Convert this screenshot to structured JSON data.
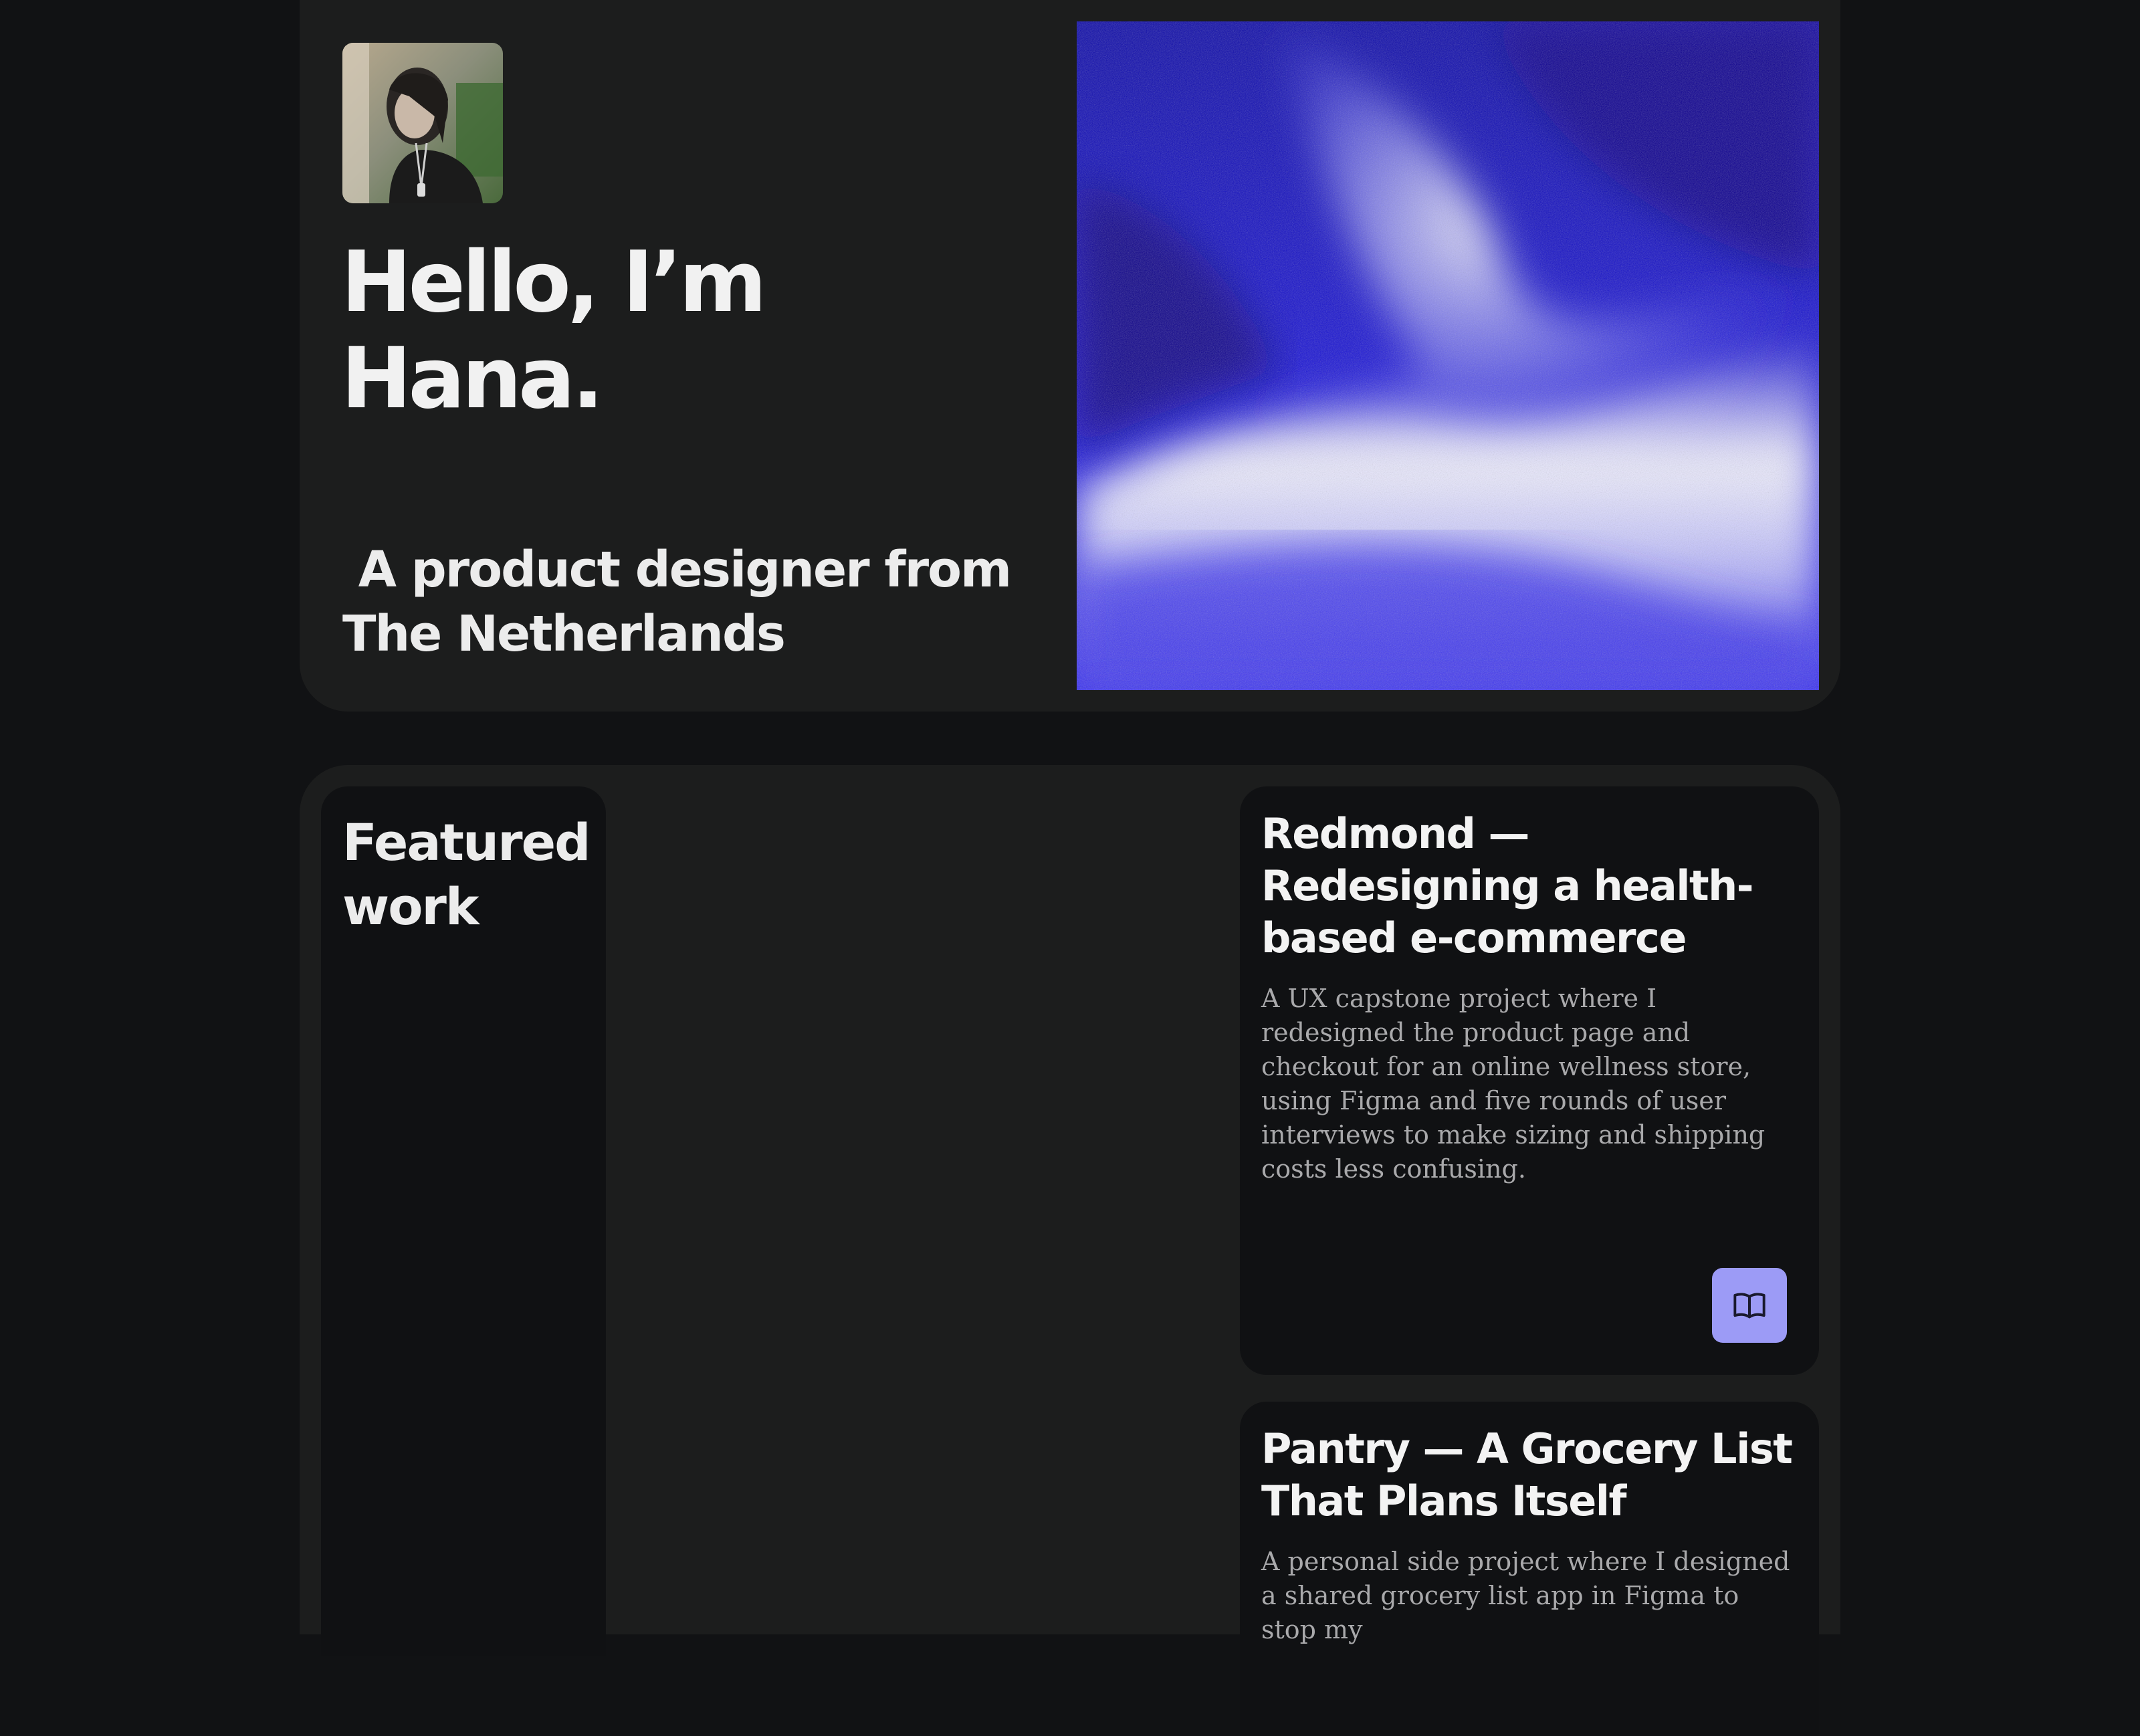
{
  "hero": {
    "avatar_alt": "Portrait of Hana",
    "greeting": "Hello, I’m Hana.",
    "tagline": " A product designer from The Netherlands",
    "art_icon": "blue-gradient-wave-artwork"
  },
  "work": {
    "title": "Featured work",
    "projects": [
      {
        "title": "Redmond — Redesigning a health-based e-commerce",
        "description": "A UX capstone project where I redesigned the product page and checkout for an online wellness store, using Figma and five rounds of user interviews to make sizing and shipping costs less confusing.",
        "action_icon": "book-open-icon"
      },
      {
        "title": "Pantry — A Grocery List That Plans Itself",
        "description": "A personal side project where I designed a shared grocery list app in Figma to stop my"
      }
    ]
  },
  "colors": {
    "page_background": "#111214",
    "section_background": "#1c1d1d",
    "card_background": "#101113",
    "accent": "#9c9bf6",
    "art_blue": "#2a1ff0"
  }
}
